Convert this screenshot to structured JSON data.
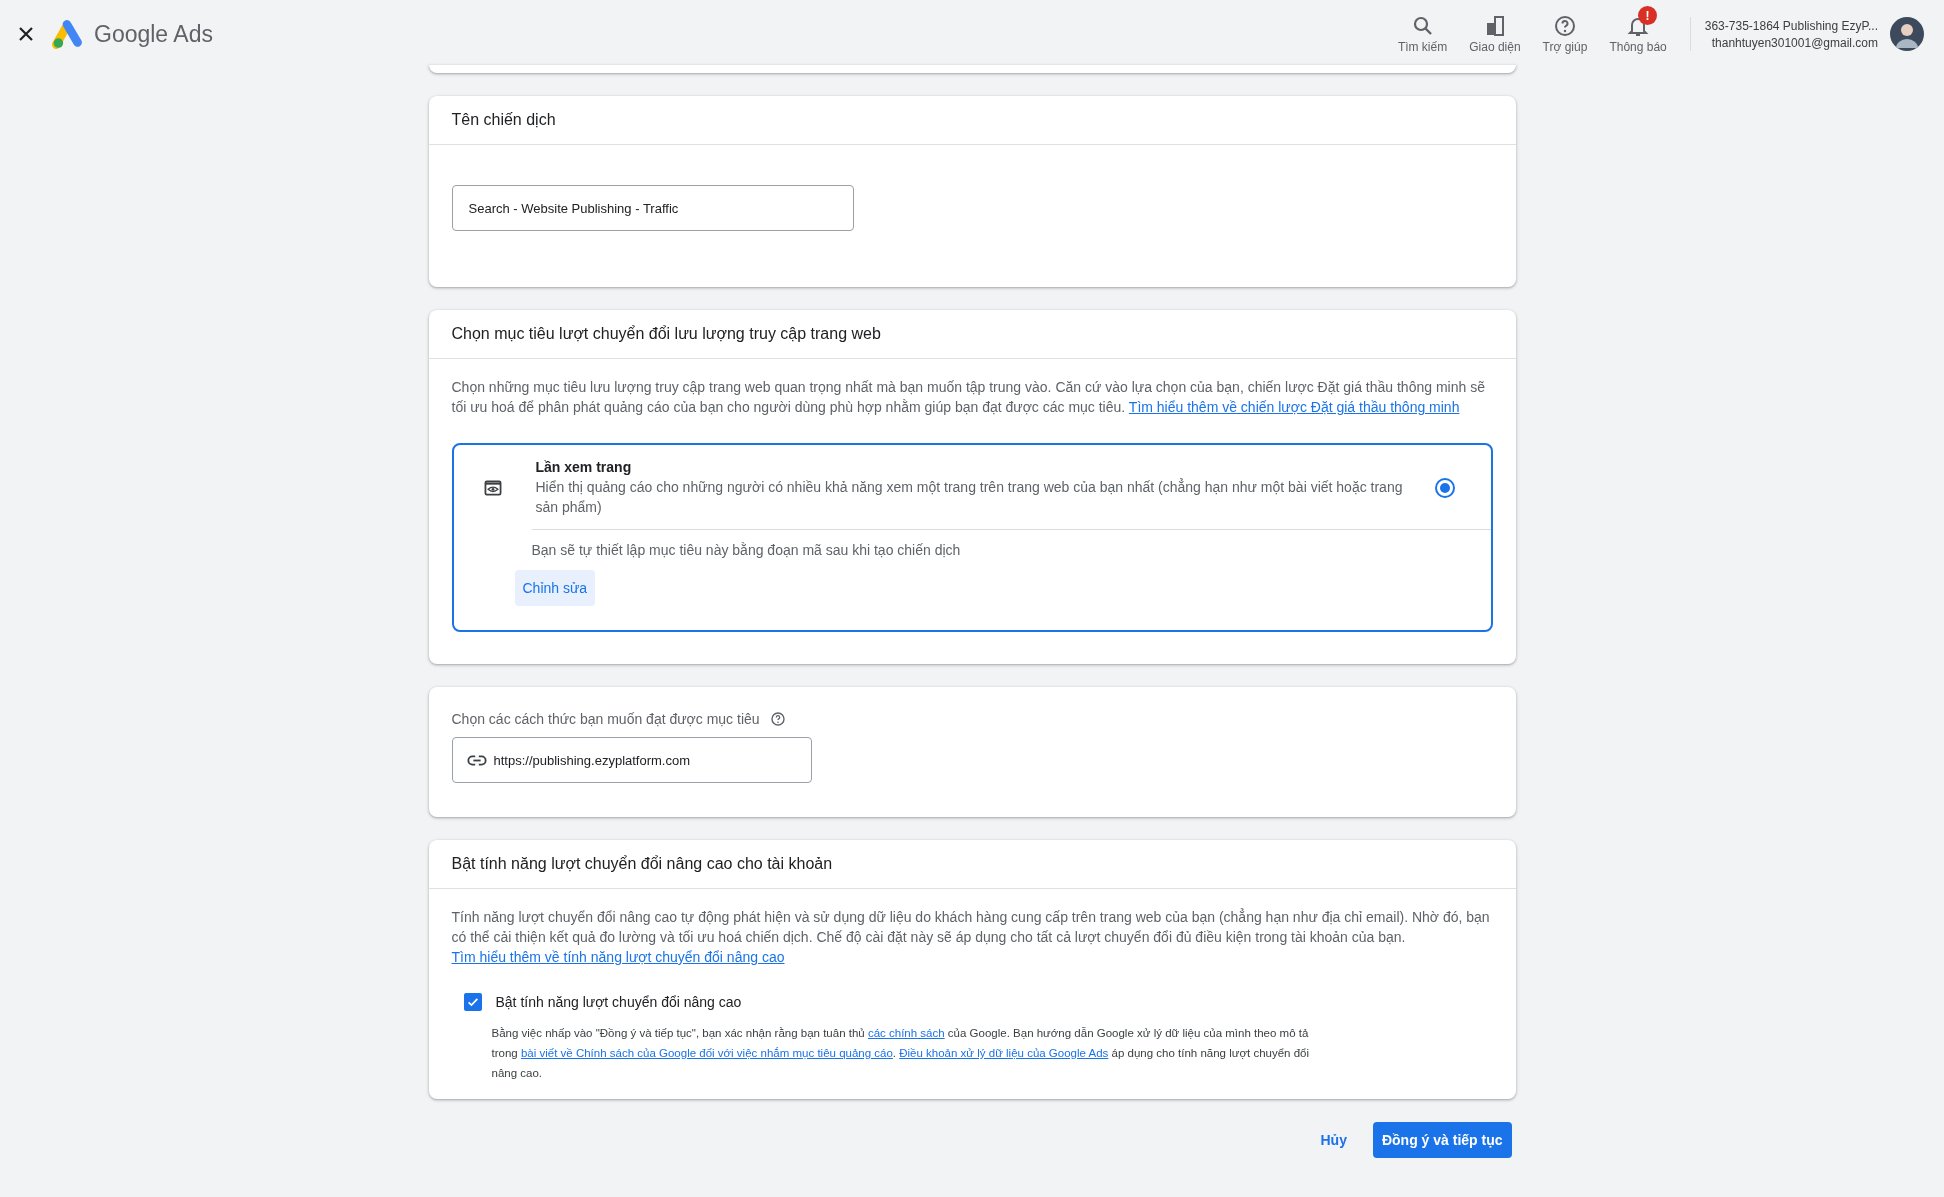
{
  "header": {
    "product": "Google Ads",
    "nav": [
      {
        "label": "Tìm kiếm",
        "kind": "search"
      },
      {
        "label": "Giao diện",
        "kind": "appearance"
      },
      {
        "label": "Trợ giúp",
        "kind": "help"
      },
      {
        "label": "Thông báo",
        "kind": "notifications",
        "badge": "!"
      }
    ],
    "account": {
      "name": "363-735-1864 Publishing EzyP...",
      "email": "thanhtuyen301001@gmail.com"
    }
  },
  "campaign_name": {
    "title": "Tên chiến dịch",
    "value": "Search - Website Publishing - Traffic"
  },
  "goal_section": {
    "title": "Chọn mục tiêu lượt chuyển đổi lưu lượng truy cập trang web",
    "description": [
      {
        "kind": "text",
        "text": "Chọn những mục tiêu lưu lượng truy cập trang web quan trọng nhất mà bạn muốn tập trung vào. Căn cứ vào lựa chọn của bạn, chiến lược Đặt giá thầu thông minh sẽ tối ưu hoá để phân phát quảng cáo của bạn cho người dùng phù hợp nhằm giúp bạn đạt được các mục tiêu. "
      },
      {
        "kind": "link",
        "text": "Tìm hiểu thêm về chiến lược Đặt giá thầu thông minh"
      }
    ],
    "options": [
      {
        "title": "Lần xem trang",
        "description": "Hiển thị quảng cáo cho những người có nhiều khả năng xem một trang trên trang web của bạn nhất (chẳng hạn như một bài viết hoặc trang sản phẩm)",
        "selected": true,
        "note": "Bạn sẽ tự thiết lập mục tiêu này bằng đoạn mã sau khi tạo chiến dịch",
        "button": "Chỉnh sửa"
      }
    ]
  },
  "methods": {
    "label": "Chọn các cách thức bạn muốn đạt được mục tiêu",
    "url": "https://publishing.ezyplatform.com"
  },
  "enhanced": {
    "title": "Bật tính năng lượt chuyển đổi nâng cao cho tài khoản",
    "description": [
      {
        "kind": "text",
        "text": "Tính năng lượt chuyển đổi nâng cao tự động phát hiện và sử dụng dữ liệu do khách hàng cung cấp trên trang web của bạn (chẳng hạn như địa chỉ email). Nhờ đó, bạn có thể cải thiện kết quả đo lường và tối ưu hoá chiến dịch. Chế độ cài đặt này sẽ áp dụng cho tất cả lượt chuyển đổi đủ điều kiện trong tài khoản của bạn. "
      },
      {
        "kind": "link",
        "text": "Tìm hiểu thêm về tính năng lượt chuyển đổi nâng cao"
      }
    ],
    "checkbox": {
      "label": "Bật tính năng lượt chuyển đổi nâng cao",
      "checked": true
    },
    "consent": [
      {
        "kind": "text",
        "text": "Bằng việc nhấp vào \"Đồng ý và tiếp tục\", bạn xác nhận rằng bạn tuân thủ "
      },
      {
        "kind": "link",
        "text": "các chính sách"
      },
      {
        "kind": "text",
        "text": " của Google. Bạn hướng dẫn Google xử lý dữ liệu của mình theo mô tả trong "
      },
      {
        "kind": "link",
        "text": "bài viết về Chính sách của Google đối với việc nhắm mục tiêu quảng cáo"
      },
      {
        "kind": "text",
        "text": ". "
      },
      {
        "kind": "link",
        "text": "Điều khoản xử lý dữ liệu của Google Ads"
      },
      {
        "kind": "text",
        "text": " áp dụng cho tính năng lượt chuyển đổi nâng cao."
      }
    ]
  },
  "footer": {
    "cancel": "Hủy",
    "confirm": "Đồng ý và tiếp tục"
  }
}
